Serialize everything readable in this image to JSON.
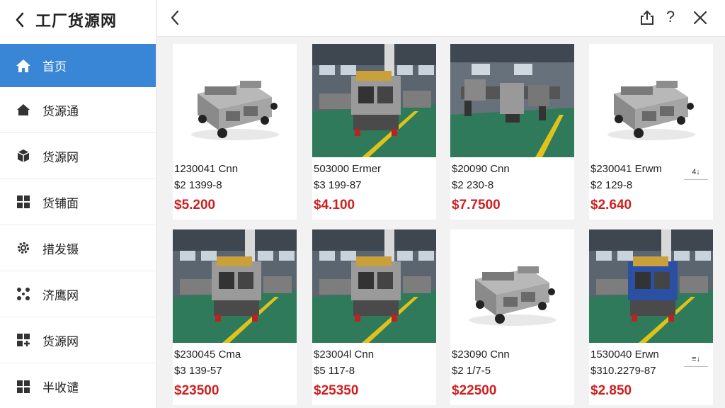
{
  "sidebar": {
    "title": "工厂货源网",
    "items": [
      {
        "label": "首页",
        "icon": "home-icon",
        "active": true
      },
      {
        "label": "货源通",
        "icon": "house-icon"
      },
      {
        "label": "货源网",
        "icon": "box-icon"
      },
      {
        "label": "货铺面",
        "icon": "grid-icon"
      },
      {
        "label": "措发镊",
        "icon": "gear-icon"
      },
      {
        "label": "济鹰网",
        "icon": "nodes-icon"
      },
      {
        "label": "货源网",
        "icon": "cube-plus-icon"
      },
      {
        "label": "半收谴",
        "icon": "grid-icon"
      }
    ]
  },
  "topbar": {
    "back_icon": "chevron-left-icon",
    "share_icon": "share-icon",
    "help_label": "?",
    "close_icon": "close-icon"
  },
  "products": [
    {
      "line1": "1230041 Cnn",
      "line2": "$2 1399-8",
      "price": "$5.200",
      "image": "cart-machine"
    },
    {
      "line1": "503000 Ermer",
      "line2": "$3 199-87",
      "price": "$4.100",
      "image": "factory-machine"
    },
    {
      "line1": "$20090 Cnn",
      "line2": "$2 230-8",
      "price": "$7.7500",
      "image": "factory-line"
    },
    {
      "line1": "$230041 Erwm",
      "line2": "$2 129-8",
      "price": "$2.640",
      "image": "cart-machine",
      "sort_label": "4↓"
    },
    {
      "line1": "$230045 Cma",
      "line2": "$3 139-57",
      "price": "$23500",
      "image": "factory-machine"
    },
    {
      "line1": "$23004l Cnn",
      "line2": "$5 117-8",
      "price": "$25350",
      "image": "factory-machine"
    },
    {
      "line1": "$23090 Cnn",
      "line2": "$2 1/7-5",
      "price": "$22500",
      "image": "cart-machine"
    },
    {
      "line1": "1530040 Erwn",
      "line2": "$310.2279-87",
      "price": "$2.850",
      "image": "factory-blue",
      "sort_label": "≡↓"
    }
  ],
  "colors": {
    "accent": "#3a86d6",
    "price": "#d11f1f",
    "floor": "#2f7a5a",
    "stripe": "#e0c21a"
  }
}
